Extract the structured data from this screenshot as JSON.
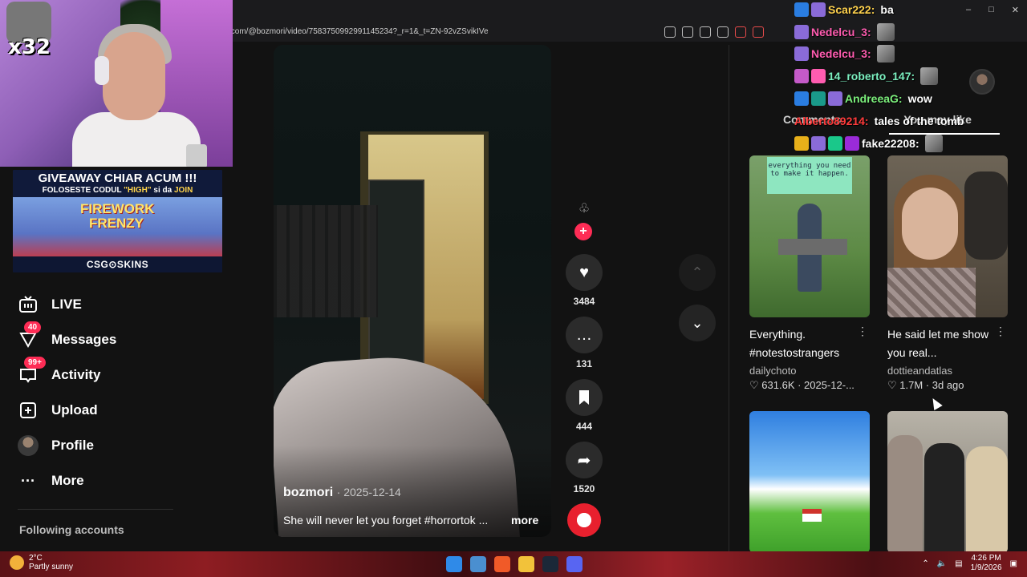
{
  "browser": {
    "url": "k.com/@bozmori/video/7583750992991145234?_r=1&_t=ZN-92vZSvikIVe"
  },
  "webcam": {
    "multiplier": "x32"
  },
  "giveaway": {
    "headline": "GIVEAWAY CHIAR ACUM !!!",
    "line2_a": "FOLOSESTE CODUL",
    "code": "\"HIGH\"",
    "line2_b": "si da",
    "join": "JOIN",
    "game": "FIREWORK FRENZY",
    "brand": "CSG⊙SKINS"
  },
  "sidebar": {
    "items": [
      {
        "label": "LIVE",
        "icon": "live-tv-icon"
      },
      {
        "label": "Messages",
        "icon": "messages-icon",
        "badge": "40"
      },
      {
        "label": "Activity",
        "icon": "activity-icon",
        "badge": "99+"
      },
      {
        "label": "Upload",
        "icon": "upload-icon"
      },
      {
        "label": "Profile",
        "icon": "profile-avatar"
      },
      {
        "label": "More",
        "icon": "more-dots-icon"
      }
    ],
    "following_heading": "Following accounts"
  },
  "video": {
    "author": "bozmori",
    "date": "· 2025-12-14",
    "description": "She will never let you forget #horrortok ...",
    "more": "more"
  },
  "actions": {
    "likes": "3484",
    "comments": "131",
    "saves": "444",
    "shares": "1520"
  },
  "right_panel": {
    "tabs": [
      "Comments",
      "You may like"
    ],
    "cards": [
      {
        "title": "Everything. #notestostrangers",
        "author": "dailychoto",
        "likes": "631.6K",
        "date": "2025-12-...",
        "note": "everything you need to make it happen."
      },
      {
        "title": "He said let me show you real...",
        "author": "dottieandatlas",
        "likes": "1.7M",
        "date": "3d ago"
      }
    ]
  },
  "chat": [
    {
      "user": "Scar222:",
      "msg": "ba",
      "color": "#ffd24d"
    },
    {
      "user": "Nedelcu_3:",
      "msg": "",
      "color": "#ff5cb0"
    },
    {
      "user": "Nedelcu_3:",
      "msg": "",
      "color": "#ff5cb0"
    },
    {
      "user": "14_roberto_147:",
      "msg": "",
      "color": "#7cf0c0"
    },
    {
      "user": "AndreeaG:",
      "msg": "wow",
      "color": "#7cf07c"
    },
    {
      "user": "Alberto89214:",
      "msg": "tales of the tomb",
      "color": "#ff3b3b"
    },
    {
      "user": "fake22208:",
      "msg": "",
      "color": "#ffffff"
    }
  ],
  "taskbar": {
    "temp": "2°C",
    "weather": "Partly sunny",
    "time": "4:26 PM",
    "date": "1/9/2026"
  }
}
